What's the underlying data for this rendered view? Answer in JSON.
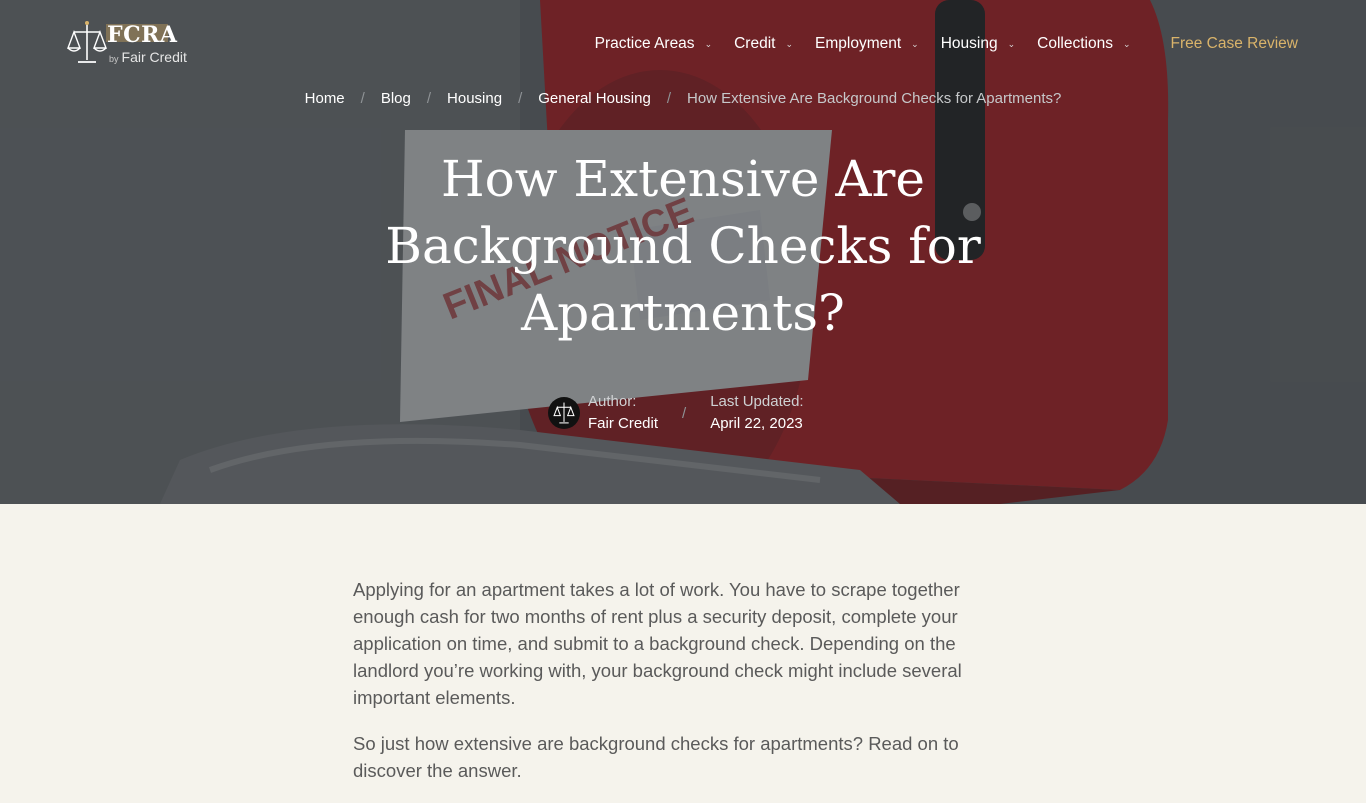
{
  "brand": {
    "title": "FCRA",
    "by": "by",
    "sub": "Fair Credit"
  },
  "nav": {
    "items": [
      {
        "label": "Practice Areas"
      },
      {
        "label": "Credit"
      },
      {
        "label": "Employment"
      },
      {
        "label": "Housing"
      },
      {
        "label": "Collections"
      }
    ],
    "cta": "Free Case Review"
  },
  "breadcrumb": {
    "items": [
      "Home",
      "Blog",
      "Housing",
      "General Housing"
    ],
    "separator": "/",
    "current": "How Extensive Are Background Checks for Apartments?"
  },
  "article": {
    "title_lines": [
      "How Extensive Are",
      "Background Checks for",
      "Apartments?"
    ],
    "author_label": "Author:",
    "author": "Fair Credit",
    "updated_label": "Last Updated:",
    "updated": "April 22, 2023",
    "paragraphs": [
      "Applying for an apartment takes a lot of work. You have to scrape together enough cash for two months of rent plus a security deposit, complete your application on time, and submit to a background check. Depending on the landlord you’re working with, your background check might include several important elements.",
      "So just how extensive are background checks for apartments? Read on to discover the answer."
    ]
  },
  "colors": {
    "accent": "#d9b36a",
    "page_bg": "#f5f3ec",
    "hero_overlay": "#2c3034"
  },
  "icons": [
    "scales-logo-icon",
    "chevron-down-icon",
    "author-avatar-icon"
  ]
}
